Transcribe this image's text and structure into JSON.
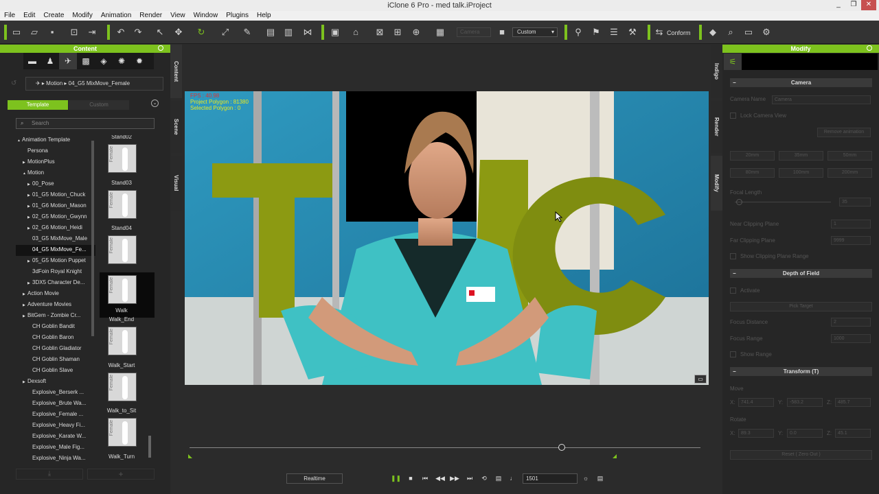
{
  "window": {
    "title": "iClone 6 Pro - med talk.iProject",
    "min": "_",
    "restore": "❐",
    "close": "✕"
  },
  "menu": [
    "File",
    "Edit",
    "Create",
    "Modify",
    "Animation",
    "Render",
    "View",
    "Window",
    "Plugins",
    "Help"
  ],
  "toolbar": {
    "camera_label": "Camera",
    "view_select": "Custom",
    "conform_label": "Conform"
  },
  "content_panel": {
    "title": "Content",
    "crumb": [
      "Motion",
      "04_G5 MixMove_Female"
    ],
    "tab_template": "Template",
    "tab_custom": "Custom",
    "search_placeholder": "Search",
    "tree": [
      {
        "label": "Animation Template",
        "indent": 0,
        "arrow": "▲"
      },
      {
        "label": "Persona",
        "indent": 1,
        "arrow": ""
      },
      {
        "label": "MotionPlus",
        "indent": 1,
        "arrow": "▶"
      },
      {
        "label": "Motion",
        "indent": 1,
        "arrow": "▲"
      },
      {
        "label": "00_Pose",
        "indent": 2,
        "arrow": "▶"
      },
      {
        "label": "01_G5 Motion_Chuck",
        "indent": 2,
        "arrow": "▶"
      },
      {
        "label": "01_G6 Motion_Mason",
        "indent": 2,
        "arrow": "▶"
      },
      {
        "label": "02_G5 Motion_Gwynn",
        "indent": 2,
        "arrow": "▶"
      },
      {
        "label": "02_G6 Motion_Heidi",
        "indent": 2,
        "arrow": "▶"
      },
      {
        "label": "03_G5 MixMove_Male",
        "indent": 2,
        "arrow": ""
      },
      {
        "label": "04_G5 MixMove_Fe...",
        "indent": 2,
        "arrow": "",
        "selected": true
      },
      {
        "label": "05_G5 Motion Puppet",
        "indent": 2,
        "arrow": "▶"
      },
      {
        "label": "3dFoin Royal Knight",
        "indent": 2,
        "arrow": ""
      },
      {
        "label": "3DX5 Character De...",
        "indent": 2,
        "arrow": "▶"
      },
      {
        "label": "Action Movie",
        "indent": 1,
        "arrow": "▶"
      },
      {
        "label": "Adventure Movies",
        "indent": 1,
        "arrow": "▶"
      },
      {
        "label": "BitGem - Zombie Cr...",
        "indent": 1,
        "arrow": "▶"
      },
      {
        "label": "CH Goblin Bandit",
        "indent": 2,
        "arrow": ""
      },
      {
        "label": "CH Goblin Baron",
        "indent": 2,
        "arrow": ""
      },
      {
        "label": "CH Goblin Gladiator",
        "indent": 2,
        "arrow": ""
      },
      {
        "label": "CH Goblin Shaman",
        "indent": 2,
        "arrow": ""
      },
      {
        "label": "CH Goblin Slave",
        "indent": 2,
        "arrow": ""
      },
      {
        "label": "Dexsoft",
        "indent": 1,
        "arrow": "▶"
      },
      {
        "label": "Explosive_Berserk ...",
        "indent": 2,
        "arrow": ""
      },
      {
        "label": "Explosive_Brute Wa...",
        "indent": 2,
        "arrow": ""
      },
      {
        "label": "Explosive_Female ...",
        "indent": 2,
        "arrow": ""
      },
      {
        "label": "Explosive_Heavy Fi...",
        "indent": 2,
        "arrow": ""
      },
      {
        "label": "Explosive_Karate W...",
        "indent": 2,
        "arrow": ""
      },
      {
        "label": "Explosive_Male Fig...",
        "indent": 2,
        "arrow": ""
      },
      {
        "label": "Explosive_Ninja Wa...",
        "indent": 2,
        "arrow": ""
      }
    ],
    "thumbs": [
      "Stand02",
      "Stand03",
      "Stand04",
      "Walk",
      "Walk_End",
      "Walk_Start",
      "Walk_to_Sit",
      "Walk_Turn"
    ],
    "thumb_tag": "Female"
  },
  "side_tabs": {
    "content": "Content",
    "scene": "Scene",
    "visual": "Visual",
    "indigo": "Indigo",
    "render": "Render",
    "modify": "Modify"
  },
  "viewport": {
    "overlay": [
      "FPS : 40.98",
      "Project Polygon : 81380",
      "Selected Polygon : 0"
    ],
    "letters": "THC",
    "badge": "+"
  },
  "modify_panel": {
    "title": "Modify",
    "camera": {
      "header": "Camera",
      "name_label": "Camera Name",
      "name_value": "Camera",
      "lock": "Lock Camera View",
      "remove": "Remove animation",
      "lens": [
        "20mm",
        "35mm",
        "50mm",
        "80mm",
        "100mm",
        "200mm"
      ],
      "focal_label": "Focal Length",
      "focal_value": "35",
      "near_label": "Near Clipping Plane",
      "near_value": "1",
      "far_label": "Far Clipping Plane",
      "far_value": "9999",
      "show_range": "Show Clipping Plane Range"
    },
    "dof": {
      "header": "Depth of Field",
      "activate": "Activate",
      "pick": "Pick Target",
      "dist_label": "Focus Distance",
      "dist_value": "2",
      "range_label": "Focus Range",
      "range_value": "1000",
      "show": "Show Range"
    },
    "transform": {
      "header": "Transform  (T)",
      "move_label": "Move",
      "move": [
        "741.4",
        "-583.2",
        "485.7"
      ],
      "rotate_label": "Rotate",
      "rotate": [
        "89.3",
        "0.0",
        "45.1"
      ],
      "reset": "Reset ( Zero Out )",
      "x": "X:",
      "y": "Y:",
      "z": "Z:"
    }
  },
  "playback": {
    "mode": "Realtime",
    "frame": "1501"
  }
}
